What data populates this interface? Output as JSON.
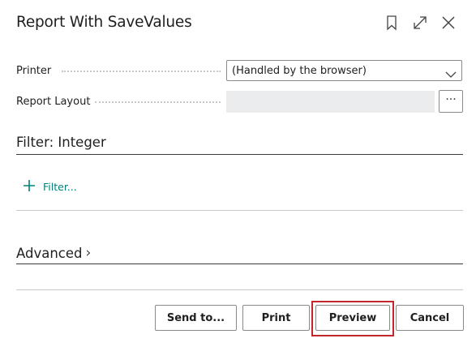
{
  "dialog": {
    "title": "Report With SaveValues"
  },
  "header_icons": [
    "bookmark-icon",
    "expand-icon",
    "close-icon"
  ],
  "fields": {
    "printer_label": "Printer",
    "printer_value": "(Handled by the browser)",
    "layout_label": "Report Layout",
    "layout_value": "",
    "ellipsis": "···"
  },
  "filter_section": {
    "title": "Filter: Integer",
    "add_filter_label": "Filter..."
  },
  "advanced_section": {
    "title": "Advanced",
    "chevron": "›"
  },
  "buttons": {
    "send_to": "Send to...",
    "print": "Print",
    "preview": "Preview",
    "cancel": "Cancel"
  },
  "colors": {
    "link_teal": "#00827a",
    "highlight_red": "#c4262e",
    "disabled_field": "#eaeced"
  }
}
